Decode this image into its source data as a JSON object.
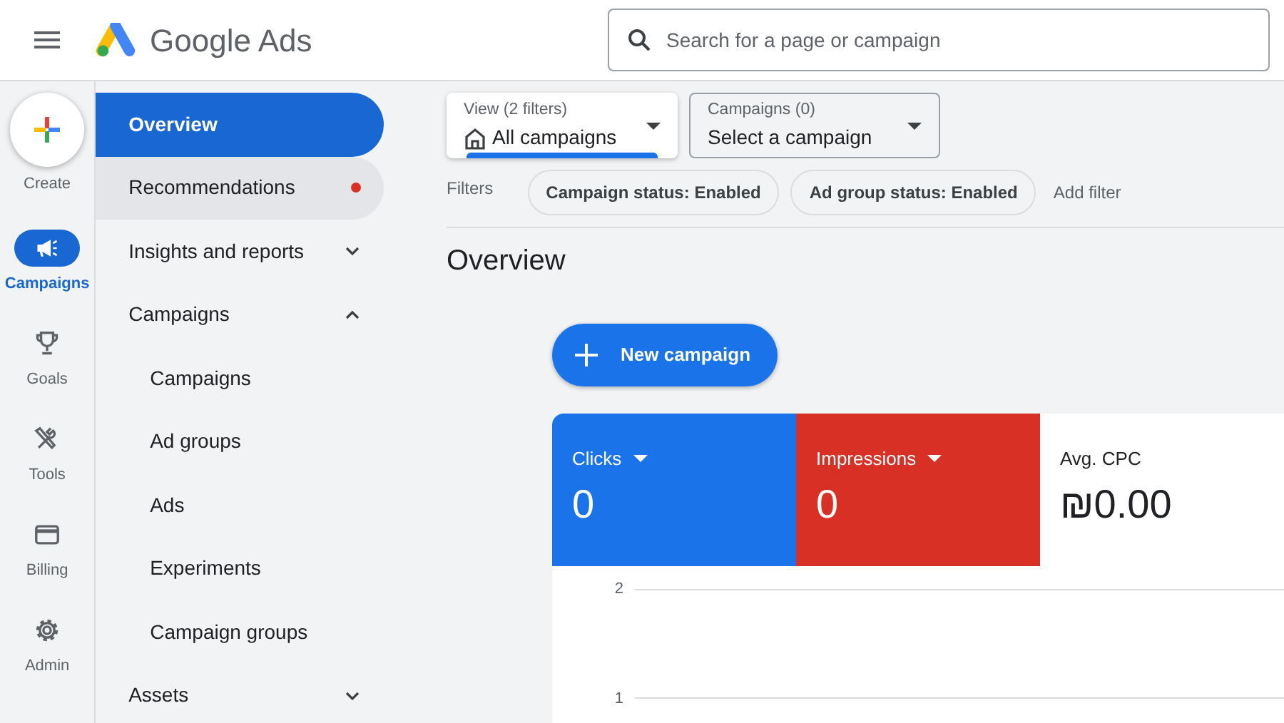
{
  "header": {
    "app_name": "Google Ads",
    "search": {
      "placeholder": "Search for a page or campaign"
    }
  },
  "rail": [
    {
      "kind": "create",
      "label": "Create",
      "selected": false
    },
    {
      "kind": "campaigns",
      "label": "Campaigns",
      "selected": true
    },
    {
      "kind": "goals",
      "label": "Goals",
      "selected": false
    },
    {
      "kind": "tools",
      "label": "Tools",
      "selected": false
    },
    {
      "kind": "billing",
      "label": "Billing",
      "selected": false
    },
    {
      "kind": "admin",
      "label": "Admin",
      "selected": false
    }
  ],
  "nav": [
    {
      "label": "Overview",
      "selected": true
    },
    {
      "label": "Recommendations",
      "selected": false,
      "highlighted": true,
      "notification": true
    },
    {
      "label": "Insights and reports",
      "selected": false,
      "expanded": false
    },
    {
      "label": "Campaigns",
      "selected": false,
      "expanded": true,
      "children": [
        {
          "label": "Campaigns",
          "selected": false
        },
        {
          "label": "Ad groups",
          "selected": false
        },
        {
          "label": "Ads",
          "selected": false
        },
        {
          "label": "Experiments",
          "selected": false
        },
        {
          "label": "Campaign groups",
          "selected": false
        }
      ]
    },
    {
      "label": "Assets",
      "selected": false,
      "expanded": false
    }
  ],
  "view_selector": {
    "caption": "View (2 filters)",
    "value": "All campaigns"
  },
  "campaign_selector": {
    "caption": "Campaigns (0)",
    "value": "Select a campaign"
  },
  "filters": {
    "label": "Filters",
    "chips": [
      "Campaign status: Enabled",
      "Ad group status: Enabled"
    ],
    "add_label": "Add filter"
  },
  "page_title": "Overview",
  "new_campaign_button": "New campaign",
  "scorecards": [
    {
      "label": "Clicks",
      "value": "0",
      "color": "#1a73e8",
      "dropdown": true
    },
    {
      "label": "Impressions",
      "value": "0",
      "color": "#d93025",
      "dropdown": true
    },
    {
      "label": "Avg. CPC",
      "value": "₪0.00",
      "color": "#ffffff",
      "dropdown": false
    }
  ],
  "chart": {
    "gridlines": [
      {
        "label": "2"
      },
      {
        "label": "1"
      }
    ]
  }
}
